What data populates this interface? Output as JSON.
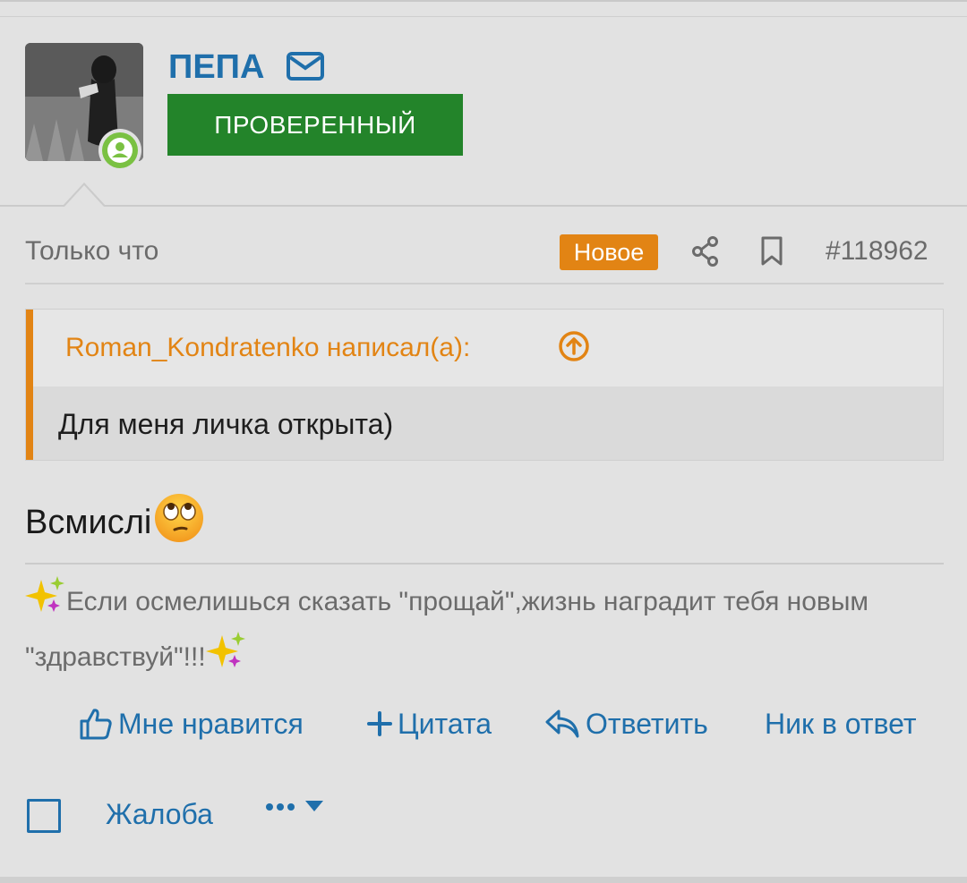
{
  "user": {
    "name": "ПЕПА",
    "badge": "ПРОВЕРЕННЫЙ"
  },
  "post": {
    "time": "Только что",
    "new_badge": "Новое",
    "number": "#118962",
    "quote": {
      "author": "Roman_Kondratenko написал(а):",
      "text": "Для меня личка открыта)"
    },
    "message": "Всмислі"
  },
  "signature": {
    "line": "Если осмелишься сказать \"прощай\",жизнь наградит тебя новым \"здравствуй\"!!!"
  },
  "actions": {
    "like": "Мне нравится",
    "quote": "Цитата",
    "reply": "Ответить",
    "nick": "Ник в ответ",
    "report": "Жалоба"
  },
  "colors": {
    "background": "#e2e2e2",
    "link": "#1f6fab",
    "verified": "#23842a",
    "accent": "#e28414",
    "online": "#7ac142"
  },
  "icons": [
    "mail-icon",
    "share-icon",
    "bookmark-icon",
    "arrow-up-circle-icon",
    "thumbs-up-icon",
    "plus-icon",
    "reply-icon",
    "sparkles-icon",
    "rolling-eyes-emoji",
    "checkbox",
    "more-dots-icon",
    "caret-down-icon"
  ]
}
